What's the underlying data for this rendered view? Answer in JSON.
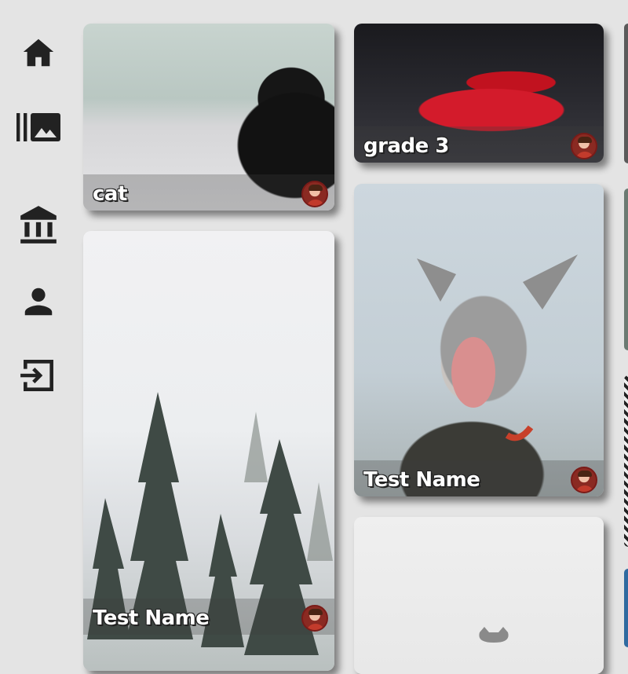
{
  "sidebar": {
    "items": [
      {
        "icon": "home-icon"
      },
      {
        "icon": "gallery-icon"
      },
      {
        "icon": "museum-icon"
      },
      {
        "icon": "person-icon"
      },
      {
        "icon": "login-icon"
      }
    ]
  },
  "cards": [
    {
      "title": "cat",
      "image": "black cat on bed"
    },
    {
      "title": "grade 3",
      "image": "red sports car"
    },
    {
      "title": "Test Name",
      "image": "foggy pine forest"
    },
    {
      "title": "Test Name",
      "image": "yawning tabby cat"
    },
    {
      "title": "",
      "image": "cat on light background"
    }
  ],
  "colors": {
    "background": "#e4e4e4",
    "icon": "#222222",
    "caption_text": "#ffffff"
  }
}
